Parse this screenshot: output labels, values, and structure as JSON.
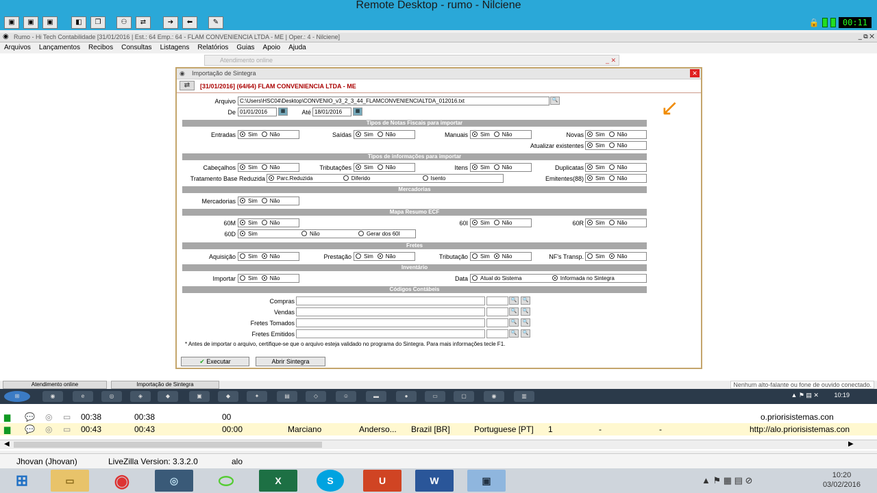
{
  "remote": {
    "title": "Remote Desktop - rumo - Nilciene",
    "timer": "00:11"
  },
  "app": {
    "title": "Rumo - Hi Tech Contabilidade [31/01/2016 | Est.: 64 Emp.: 64 - FLAM CONVENIENCIA LTDA - ME | Oper.: 4 - Nilciene]"
  },
  "menu": [
    "Arquivos",
    "Lançamentos",
    "Recibos",
    "Consultas",
    "Listagens",
    "Relatórios",
    "Guias",
    "Apoio",
    "Ajuda"
  ],
  "atendimento_title": "Atendimento online",
  "dialog": {
    "title": "Importação de Sintegra",
    "header": "[31/01/2016] (64/64) FLAM CONVENIENCIA LTDA - ME",
    "arquivo_label": "Arquivo",
    "arquivo_value": "C:\\Users\\HSC04\\Desktop\\CONVENIO_v3_2_3_44_FLAMCONVENIENCIALTDA_012016.txt",
    "de_label": "De",
    "de_value": "01/01/2016",
    "ate_label": "Até",
    "ate_value": "18/01/2016",
    "sec_notas": "Tipos de Notas Fiscais para importar",
    "sec_info": "Tipos de informações para importar",
    "sec_merc": "Mercadorias",
    "sec_mapa": "Mapa Resumo ECF",
    "sec_fretes": "Fretes",
    "sec_inv": "Inventário",
    "sec_cod": "Códigos Contábeis",
    "sim": "Sim",
    "nao": "Não",
    "l_entradas": "Entradas",
    "l_saidas": "Saídas",
    "l_manuais": "Manuais",
    "l_novas": "Novas",
    "l_atualizar": "Atualizar existentes",
    "l_cabecalhos": "Cabeçalhos",
    "l_tributacoes": "Tributações",
    "l_itens": "Itens",
    "l_duplicatas": "Duplicatas",
    "l_trat": "Tratamento Base Reduzida",
    "o_parc": "Parc.Reduzida",
    "o_diferido": "Diferido",
    "o_isento": "Isento",
    "l_emitentes": "Emitentes(88)",
    "l_mercadorias": "Mercadorias",
    "l_60m": "60M",
    "l_60i": "60I",
    "l_60r": "60R",
    "l_60d": "60D",
    "o_gerar": "Gerar dos 60I",
    "l_aquisicao": "Aquisição",
    "l_prestacao": "Prestação",
    "l_tributacao": "Tributação",
    "l_nfs": "NF's Transp.",
    "l_importar": "Importar",
    "l_data": "Data",
    "o_atual": "Atual do Sistema",
    "o_informada": "Informada no Sintegra",
    "l_compras": "Compras",
    "l_vendas": "Vendas",
    "l_fretes_tom": "Fretes Tomados",
    "l_fretes_emi": "Fretes Emitidos",
    "note": "* Antes de importar o arquivo, certifique-se que o arquivo esteja validado no programa do Sintegra. Para mais informações tecle F1.",
    "btn_executar": "Executar",
    "btn_abrir": "Abrir Sintegra"
  },
  "app_tabs": [
    "Atendimento online",
    "Importação de Sintegra"
  ],
  "speaker_msg": "Nenhum alto-falante ou fone de ouvido conectado.",
  "remote_clock": "10:19",
  "livezilla": {
    "rows": [
      {
        "t1": "00:38",
        "t2": "00:38",
        "t3": "00",
        "url": "o.priorisistemas.con"
      },
      {
        "t1": "00:43",
        "t2": "00:43",
        "t3": "00:00",
        "name": "Marciano",
        "op": "Anderso...",
        "country": "Brazil [BR]",
        "lang": "Portuguese [PT]",
        "n": "1",
        "d1": "-",
        "d2": "-",
        "url": "http://alo.priorisistemas.con"
      }
    ],
    "status_user": "Jhovan (Jhovan)",
    "status_version": "LiveZilla Version: 3.3.2.0",
    "status_msg": "alo"
  },
  "win_clock": {
    "time": "10:20",
    "date": "03/02/2016"
  }
}
